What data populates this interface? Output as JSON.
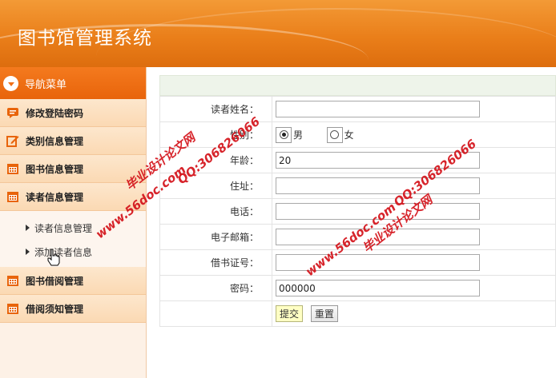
{
  "header": {
    "title": "图书馆管理系统"
  },
  "sidebar": {
    "nav_title": "导航菜单",
    "items": [
      {
        "label": "修改登陆密码",
        "icon": "speech-bubble-icon"
      },
      {
        "label": "类别信息管理",
        "icon": "edit-icon"
      },
      {
        "label": "图书信息管理",
        "icon": "calendar-icon"
      },
      {
        "label": "读者信息管理",
        "icon": "calendar-icon"
      }
    ],
    "sub_items": [
      {
        "label": "读者信息管理"
      },
      {
        "label": "添加读者信息"
      }
    ],
    "items_after": [
      {
        "label": "图书借阅管理",
        "icon": "calendar-icon"
      },
      {
        "label": "借阅须知管理",
        "icon": "calendar-icon"
      }
    ]
  },
  "form": {
    "name_label": "读者姓名：",
    "name_value": "",
    "gender_label": "性别：",
    "gender_male": "男",
    "gender_female": "女",
    "gender_selected": "男",
    "age_label": "年龄：",
    "age_value": "20",
    "address_label": "住址：",
    "address_value": "",
    "phone_label": "电话：",
    "phone_value": "",
    "email_label": "电子邮箱：",
    "email_value": "",
    "card_label": "借书证号：",
    "card_value": "",
    "password_label": "密码：",
    "password_value": "000000",
    "submit_label": "提交",
    "reset_label": "重置"
  },
  "watermarks": {
    "site": "www.56doc.com",
    "qq": "QQ:306826066",
    "brand": "毕业设计论文网"
  },
  "colors": {
    "accent": "#e8640b",
    "watermark": "#d4141b"
  }
}
